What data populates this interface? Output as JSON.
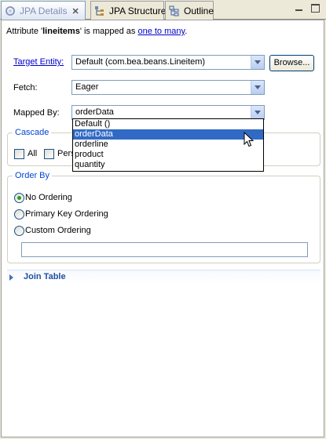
{
  "tabs": [
    {
      "label": "JPA Details",
      "close": "✕",
      "icon": "jpa-details-icon"
    },
    {
      "label": "JPA Structure",
      "icon": "jpa-structure-icon"
    },
    {
      "label": "Outline",
      "icon": "outline-icon"
    }
  ],
  "mapping": {
    "prefix": "Attribute '",
    "attribute": "lineitems",
    "middle": "' is mapped as ",
    "link": "one to many",
    "suffix": "."
  },
  "target_entity": {
    "label": "Target Entity:",
    "value": "Default (com.bea.beans.Lineitem)",
    "browse": "Browse..."
  },
  "fetch": {
    "label": "Fetch:",
    "value": "Eager"
  },
  "mapped_by": {
    "label": "Mapped By:",
    "value": "orderData",
    "options": [
      "Default ()",
      "orderData",
      "orderline",
      "product",
      "quantity"
    ],
    "selected_index": 1
  },
  "cascade": {
    "title": "Cascade",
    "options": [
      "All",
      "Pers"
    ]
  },
  "order_by": {
    "title": "Order By",
    "options": [
      "No Ordering",
      "Primary Key Ordering",
      "Custom Ordering"
    ],
    "selected": "No Ordering",
    "custom_value": ""
  },
  "join_table": {
    "title": "Join Table"
  },
  "colors": {
    "selection": "#316ac5",
    "link": "#0000cc",
    "group_title": "#0046d5",
    "section_title": "#1f4f9e"
  }
}
